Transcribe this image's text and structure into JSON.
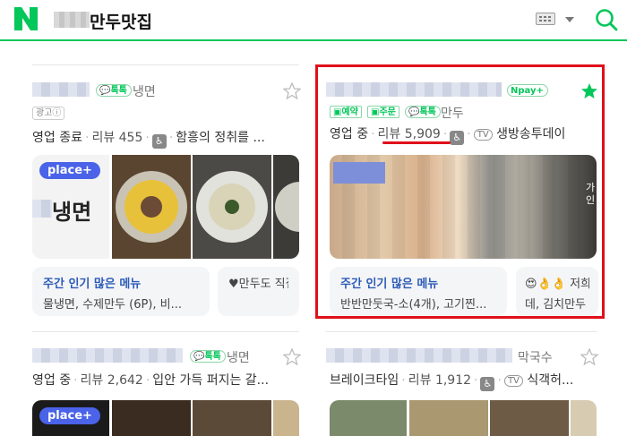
{
  "header": {
    "query_suffix": "만두맛집"
  },
  "cards": [
    {
      "category": "냉면",
      "badge_talk": "톡톡",
      "ad_label": "광고ⓘ",
      "status": "영업 종료",
      "review_label": "리뷰 455",
      "description": "함흥의 정취를 ...",
      "place_plus": "place+",
      "img_text": "냉면",
      "menu_title": "주간 인기 많은 메뉴",
      "menu_items": "물냉면, 수제만두 (6P), 비...",
      "menu2_title": "♥만두도 직접"
    },
    {
      "badge_npay": "Npay",
      "badge_reserve": "예약",
      "badge_order": "주문",
      "badge_talk": "톡톡",
      "category": "만두",
      "status": "영업 중",
      "review_label": "리뷰 5,909",
      "tv": "TV",
      "tv_label": "생방송투데이",
      "menu_title": "주간 인기 많은 메뉴",
      "menu_items": "반반만둣국-소(4개), 고기찐...",
      "menu2_title": "저희",
      "menu2_items": "데, 김치만두",
      "side_text": "가인"
    },
    {
      "category": "냉면",
      "badge_talk": "톡톡",
      "status": "영업 중",
      "review_label": "리뷰 2,642",
      "description": "입안 가득 퍼지는 갈...",
      "place_plus": "place+"
    },
    {
      "category": "막국수",
      "name_tail": "브레이크타임",
      "review_label": "리뷰 1,912",
      "tv": "TV",
      "tv_label": "식객허..."
    }
  ]
}
